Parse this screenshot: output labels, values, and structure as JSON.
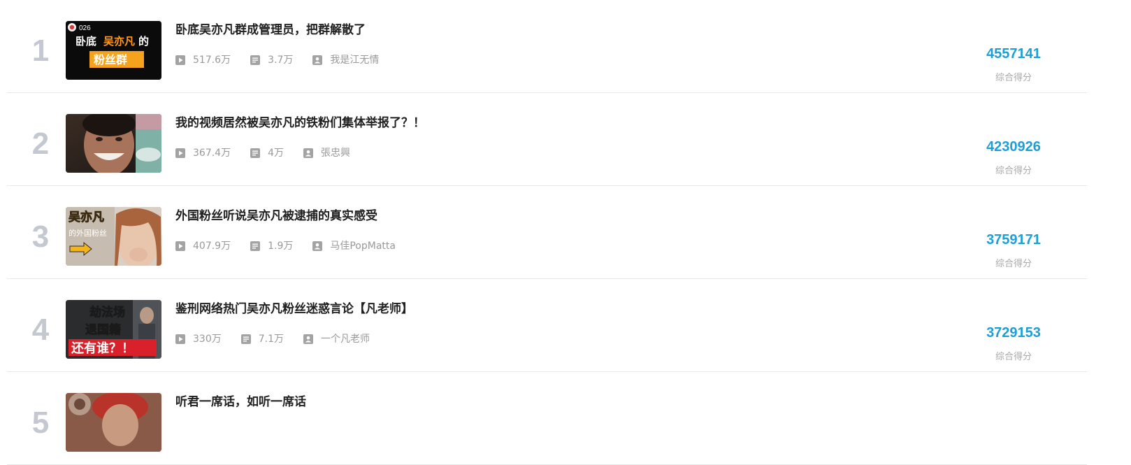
{
  "rank_list": {
    "score_label": "综合得分",
    "items": [
      {
        "rank": "1",
        "title": "卧底吴亦凡群成管理员，把群解散了",
        "plays": "517.6万",
        "danmaku": "3.7万",
        "author": "我是江无情",
        "score": "4557141",
        "thumbnail_text": {
          "episode": "026",
          "line1": "卧底",
          "line1_highlight": "吴亦凡",
          "line1_end": "的",
          "banner": "粉丝群"
        }
      },
      {
        "rank": "2",
        "title": "我的视频居然被吴亦凡的铁粉们集体举报了？！",
        "plays": "367.4万",
        "danmaku": "4万",
        "author": "張忠興",
        "score": "4230926"
      },
      {
        "rank": "3",
        "title": "外国粉丝听说吴亦凡被逮捕的真实感受",
        "plays": "407.9万",
        "danmaku": "1.9万",
        "author": "马佳PopMatta",
        "score": "3759171",
        "thumbnail_text": {
          "line1": "吴亦凡",
          "line2": "的外国粉丝"
        }
      },
      {
        "rank": "4",
        "title": "鉴刑网络热门吴亦凡粉丝迷惑言论【凡老师】",
        "plays": "330万",
        "danmaku": "7.1万",
        "author": "一个凡老师",
        "score": "3729153",
        "thumbnail_text": {
          "line1": "劫法场",
          "line2": "退国籍",
          "line3": "还有谁？！"
        }
      },
      {
        "rank": "5",
        "title": "听君一席话，如听一席话"
      }
    ]
  },
  "icons": {
    "plays": "play-icon",
    "danmaku": "danmaku-icon",
    "author": "uploader-icon"
  },
  "colors": {
    "rank_number": "#c3c8d1",
    "score": "#1c9fd6",
    "meta_text": "#999999",
    "divider": "#e7e7e7"
  }
}
